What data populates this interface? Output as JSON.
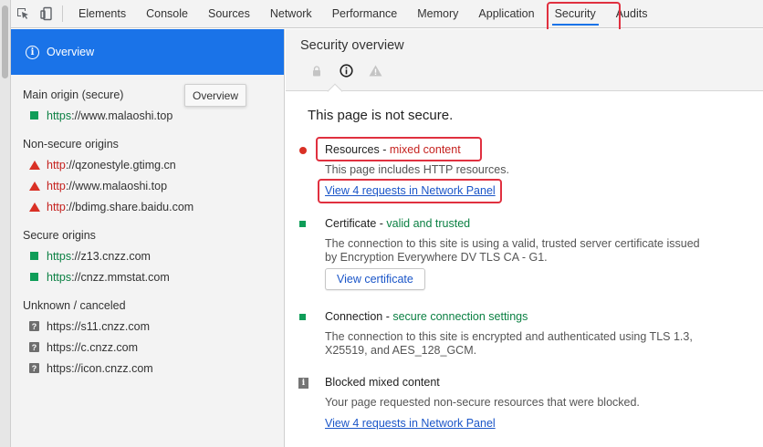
{
  "toolbar": {
    "tabs": [
      "Elements",
      "Console",
      "Sources",
      "Network",
      "Performance",
      "Memory",
      "Application",
      "Security",
      "Audits"
    ],
    "active_tab": "Security",
    "accent_color": "#1a73e8",
    "highlight_color": "#e0303f"
  },
  "sidebar": {
    "overview_label": "Overview",
    "tooltip": "Overview",
    "main_origin": {
      "heading": "Main origin (secure)",
      "items": [
        {
          "scheme": "https",
          "rest": "://www.malaoshi.top"
        }
      ]
    },
    "non_secure": {
      "heading": "Non-secure origins",
      "items": [
        {
          "scheme": "http",
          "rest": "://qzonestyle.gtimg.cn"
        },
        {
          "scheme": "http",
          "rest": "://www.malaoshi.top"
        },
        {
          "scheme": "http",
          "rest": "://bdimg.share.baidu.com"
        }
      ]
    },
    "secure": {
      "heading": "Secure origins",
      "items": [
        {
          "scheme": "https",
          "rest": "://z13.cnzz.com"
        },
        {
          "scheme": "https",
          "rest": "://cnzz.mmstat.com"
        }
      ]
    },
    "unknown": {
      "heading": "Unknown / canceled",
      "items": [
        {
          "text": "https://s11.cnzz.com"
        },
        {
          "text": "https://c.cnzz.com"
        },
        {
          "text": "https://icon.cnzz.com"
        }
      ]
    }
  },
  "main": {
    "title": "Security overview",
    "header_icons": [
      "lock-icon",
      "info-icon",
      "warning-icon"
    ],
    "summary": "This page is not secure.",
    "resources": {
      "title": "Resources",
      "sep": " - ",
      "status": "mixed content",
      "desc": "This page includes HTTP resources.",
      "link": "View 4 requests in Network Panel"
    },
    "certificate": {
      "title": "Certificate",
      "sep": " - ",
      "status": "valid and trusted",
      "desc_line1": "The connection to this site is using a valid, trusted server certificate issued",
      "desc_line2": "by Encryption Everywhere DV TLS CA - G1.",
      "button": "View certificate"
    },
    "connection": {
      "title": "Connection",
      "sep": " - ",
      "status": "secure connection settings",
      "desc_line1": "The connection to this site is encrypted and authenticated using TLS 1.3,",
      "desc_line2": "X25519, and AES_128_GCM."
    },
    "blocked": {
      "title": "Blocked mixed content",
      "desc": "Your page requested non-secure resources that were blocked.",
      "link": "View 4 requests in Network Panel"
    }
  }
}
